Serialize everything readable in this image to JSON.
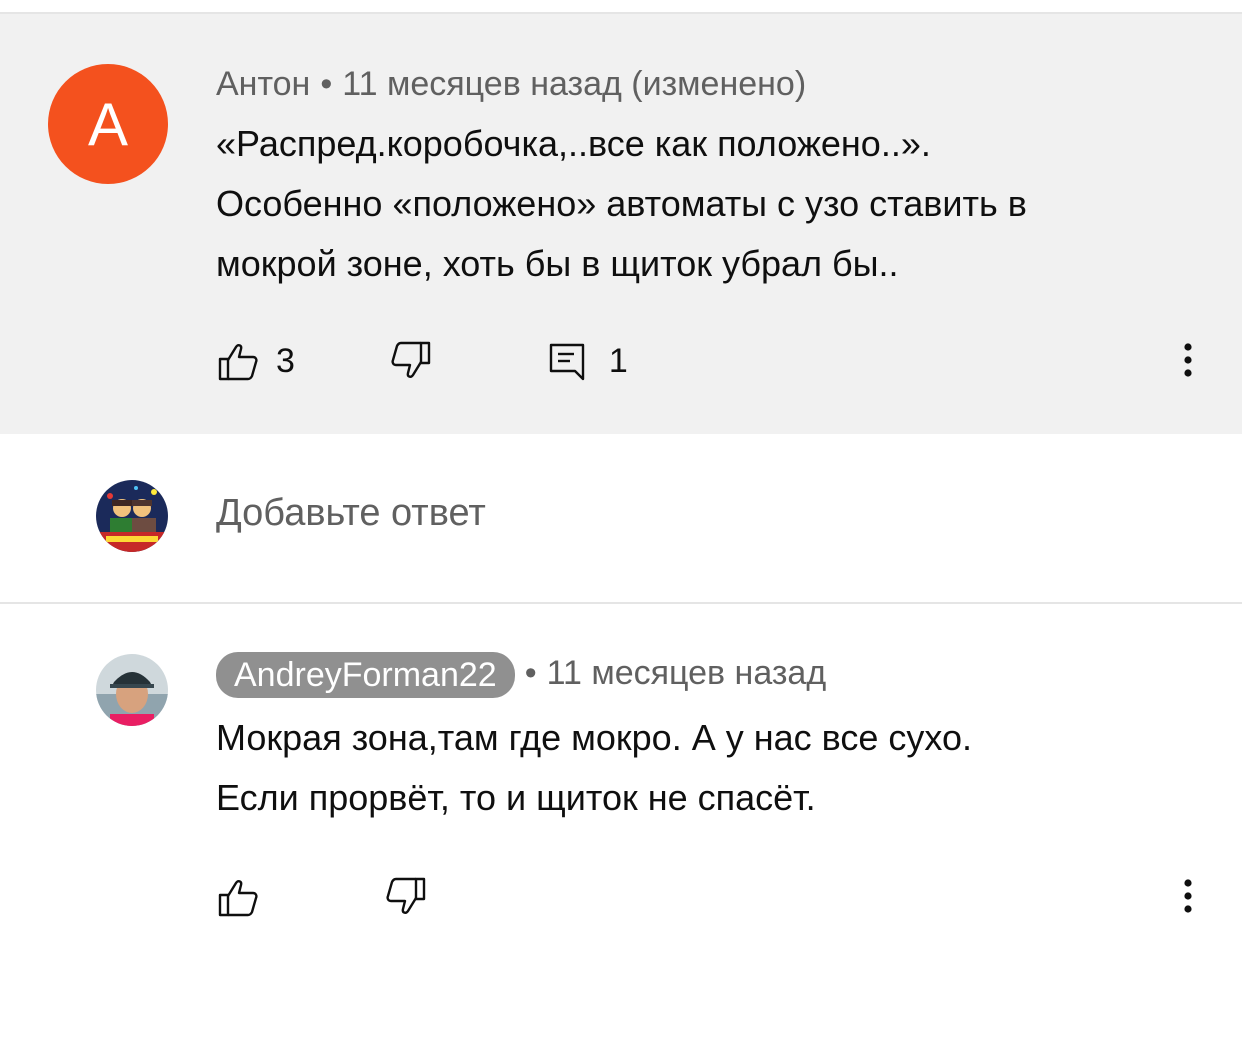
{
  "comment": {
    "avatar_letter": "A",
    "author": "Антон",
    "separator": "•",
    "time": "11 месяцев назад (изменено)",
    "lines": [
      "«Распред.коробочка,..все как положено..».",
      "Особенно «положено» автоматы с узо ставить в",
      "мокрой зоне, хоть бы в щиток убрал бы.."
    ],
    "like_count": "3",
    "reply_count": "1",
    "icons": {
      "like": "thumb-up-icon",
      "dislike": "thumb-down-icon",
      "reply": "comment-icon",
      "more": "more-vert-icon"
    },
    "colors": {
      "avatar_bg": "#f4511e",
      "background": "#f1f1f1"
    }
  },
  "add_reply": {
    "placeholder": "Добавьте ответ"
  },
  "reply": {
    "author": "AndreyForman22",
    "separator": "•",
    "time": "11 месяцев назад",
    "lines": [
      "Мокрая зона,там где мокро. А у нас все сухо.",
      "Если прорвёт, то и щиток не спасёт."
    ]
  }
}
